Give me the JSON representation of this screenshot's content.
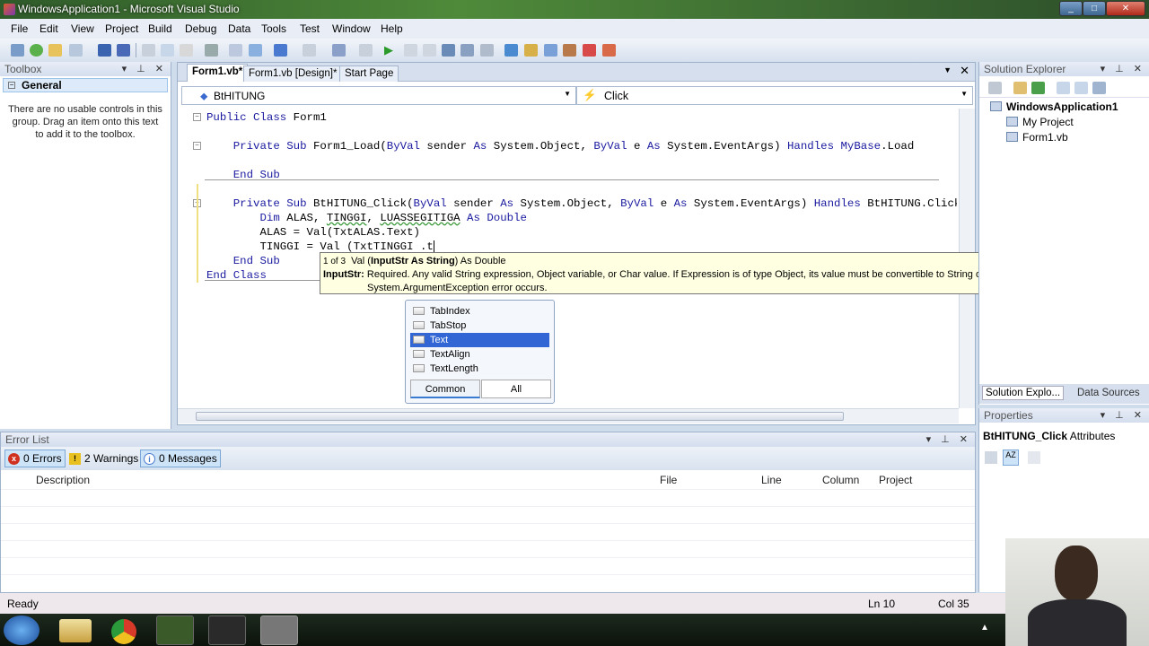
{
  "window": {
    "title": "WindowsApplication1 - Microsoft Visual Studio"
  },
  "menu": [
    "File",
    "Edit",
    "View",
    "Project",
    "Build",
    "Debug",
    "Data",
    "Tools",
    "Test",
    "Window",
    "Help"
  ],
  "toolbox": {
    "title": "Toolbox",
    "group": "General",
    "message": "There are no usable controls in this group. Drag an item onto this text to add it to the toolbox."
  },
  "editor": {
    "tabs": [
      "Form1.vb*",
      "Form1.vb [Design]*",
      "Start Page"
    ],
    "class_dropdown": "BtHITUNG",
    "method_dropdown": "Click",
    "lines": [
      [
        {
          "k": 1,
          "t": "Public Class"
        },
        {
          "t": " Form1"
        }
      ],
      [],
      [
        {
          "t": "    "
        },
        {
          "k": 1,
          "t": "Private Sub"
        },
        {
          "t": " Form1_Load("
        },
        {
          "k": 1,
          "t": "ByVal"
        },
        {
          "t": " sender "
        },
        {
          "k": 1,
          "t": "As"
        },
        {
          "t": " System.Object, "
        },
        {
          "k": 1,
          "t": "ByVal"
        },
        {
          "t": " e "
        },
        {
          "k": 1,
          "t": "As"
        },
        {
          "t": " System.EventArgs) "
        },
        {
          "k": 1,
          "t": "Handles"
        },
        {
          "t": " "
        },
        {
          "k": 1,
          "t": "MyBase"
        },
        {
          "t": ".Load"
        }
      ],
      [],
      [
        {
          "t": "    "
        },
        {
          "k": 1,
          "t": "End Sub"
        }
      ],
      [],
      [
        {
          "t": "    "
        },
        {
          "k": 1,
          "t": "Private Sub"
        },
        {
          "t": " BtHITUNG_Click("
        },
        {
          "k": 1,
          "t": "ByVal"
        },
        {
          "t": " sender "
        },
        {
          "k": 1,
          "t": "As"
        },
        {
          "t": " System.Object, "
        },
        {
          "k": 1,
          "t": "ByVal"
        },
        {
          "t": " e "
        },
        {
          "k": 1,
          "t": "As"
        },
        {
          "t": " System.EventArgs) "
        },
        {
          "k": 1,
          "t": "Handles"
        },
        {
          "t": " BtHITUNG.Click"
        }
      ],
      [
        {
          "t": "        "
        },
        {
          "k": 1,
          "t": "Dim"
        },
        {
          "t": " ALAS, "
        },
        {
          "s": 1,
          "t": "TINGGI"
        },
        {
          "t": ", "
        },
        {
          "s": 1,
          "t": "LUASSEGITIGA"
        },
        {
          "t": " "
        },
        {
          "k": 1,
          "t": "As Double"
        }
      ],
      [
        {
          "t": "        ALAS = Val(TxtALAS.Text)"
        }
      ],
      [
        {
          "t": "        TINGGI = Val (TxtTINGGI .t"
        }
      ],
      [
        {
          "t": "    "
        },
        {
          "k": 1,
          "t": "End Sub"
        }
      ],
      [
        {
          "k": 1,
          "t": "End Class"
        }
      ]
    ]
  },
  "tooltip": {
    "counter": "1 of 3",
    "sig_pre": "Val (",
    "sig_bold": "InputStr As String",
    "sig_post": ") As Double",
    "param": "InputStr:",
    "desc1": "Required. Any valid String expression, Object variable, or Char value. If Expression is of type Object, its value must be convertible to String or an",
    "desc2": "System.ArgumentException error occurs."
  },
  "intellisense": {
    "items": [
      "TabIndex",
      "TabStop",
      "Text",
      "TextAlign",
      "TextLength"
    ],
    "selected": "Text",
    "tabs": [
      "Common",
      "All"
    ]
  },
  "solution_explorer": {
    "title": "Solution Explorer",
    "items": [
      "WindowsApplication1",
      "My Project",
      "Form1.vb"
    ],
    "bottom_tabs": [
      "Solution Explo...",
      "Data Sources"
    ]
  },
  "properties": {
    "title": "Properties",
    "object": "BtHITUNG_Click",
    "object_type": "Attributes"
  },
  "error_list": {
    "title": "Error List",
    "errors": "0 Errors",
    "warnings": "2 Warnings",
    "messages": "0 Messages",
    "columns": [
      "Description",
      "File",
      "Line",
      "Column",
      "Project"
    ]
  },
  "status": {
    "text": "Ready",
    "ln": "Ln 10",
    "col": "Col 35"
  }
}
